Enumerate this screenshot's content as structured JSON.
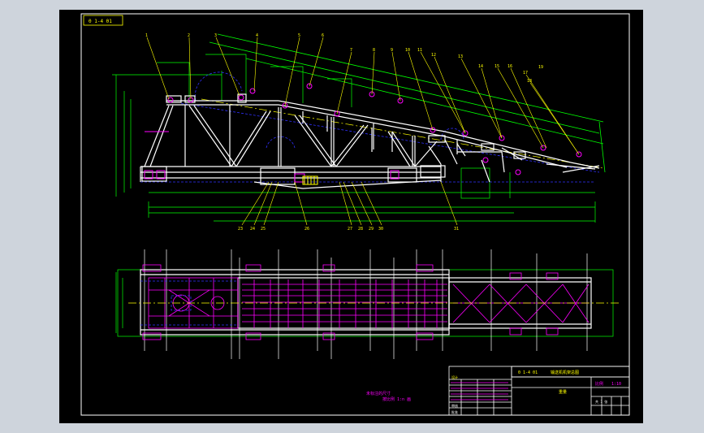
{
  "drawing": {
    "code_box": "0 1-4 01",
    "front_view_callouts": [
      "1",
      "2",
      "3",
      "4",
      "5",
      "6",
      "7",
      "8",
      "9",
      "10",
      "11",
      "12",
      "13",
      "14",
      "15",
      "16",
      "17",
      "18",
      "19"
    ],
    "bottom_callouts": [
      "23",
      "24",
      "25",
      "26",
      "27",
      "28",
      "29",
      "30",
      "31"
    ],
    "center_note_line1": "未标注的尺寸",
    "center_note_line2": "按比例 1:n 画",
    "title_block": {
      "drawing_title": "0 1-4 01",
      "drawing_name": "输送机机架总图",
      "weight_label": "重量",
      "scale_label": "比例",
      "scale_value": "1:10",
      "sheet_label": "共 1 张",
      "designer_label": "设计",
      "checker_label": "审核",
      "approve_label": "批准"
    }
  },
  "colors": {
    "sheet_bg": "#000000",
    "frame_outer": "#ffffff",
    "frame_inner": "#ffffff",
    "structure": "#ffffff",
    "dimension": "#00ff00",
    "centerline": "#ffff00",
    "hidden": "#3030ff",
    "annotation": "#ff00ff",
    "callout": "#ffff00"
  }
}
